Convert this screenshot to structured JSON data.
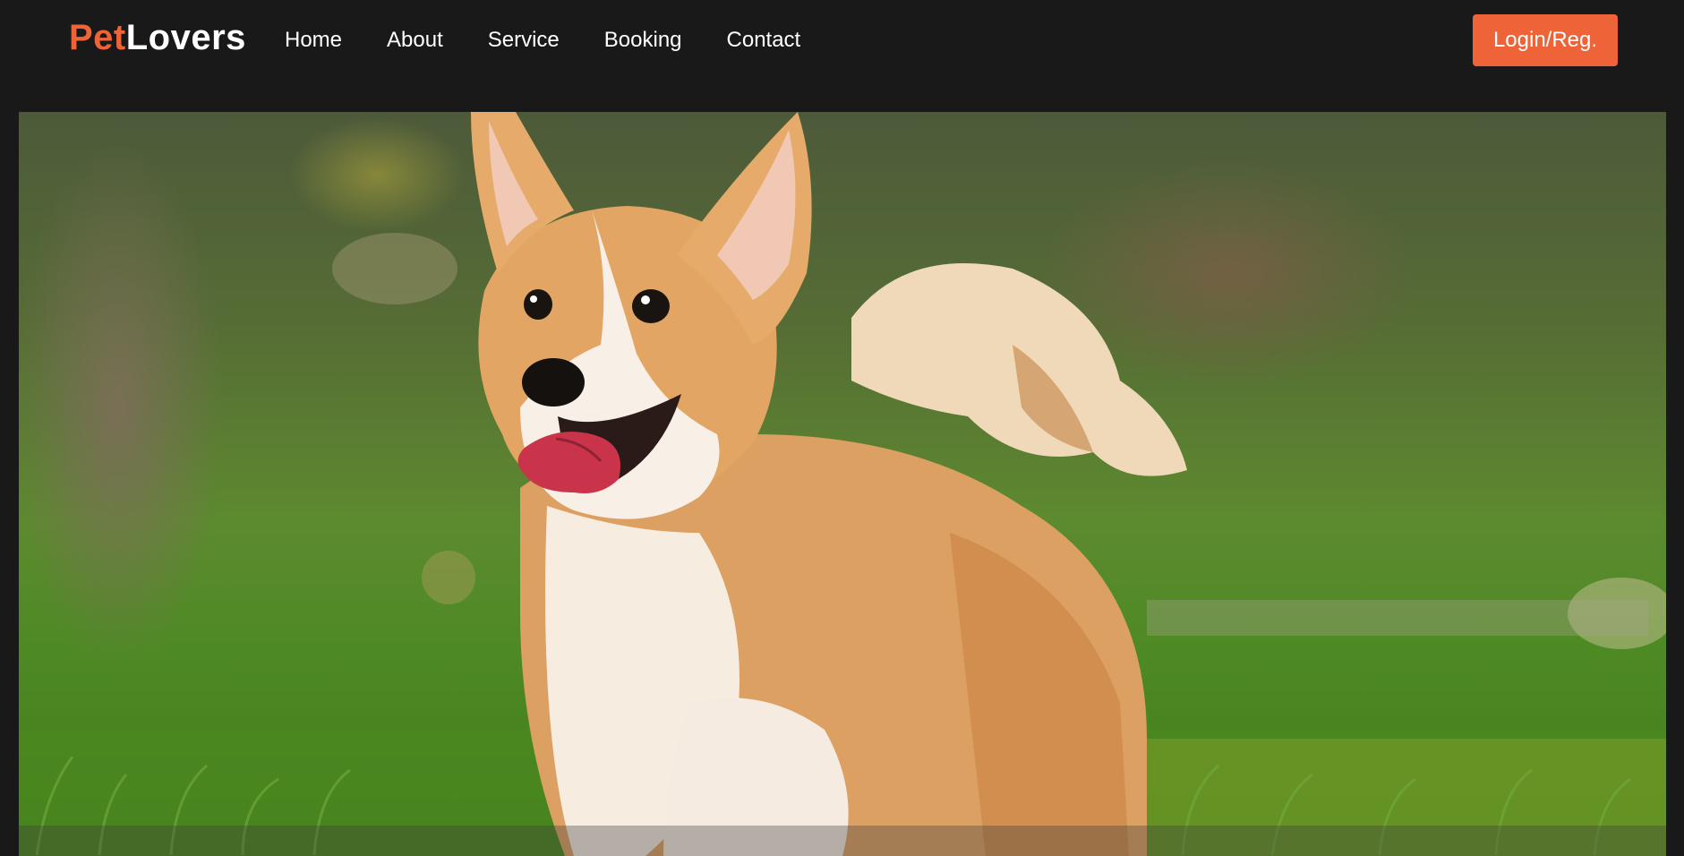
{
  "brand": {
    "part1": "Pet",
    "part2": "Lovers",
    "part1_color": "#ee6337",
    "part2_color": "#ffffff"
  },
  "nav": {
    "items": [
      {
        "label": "Home"
      },
      {
        "label": "About"
      },
      {
        "label": "Service"
      },
      {
        "label": "Booking"
      },
      {
        "label": "Contact"
      }
    ]
  },
  "header": {
    "login_label": "Login/Reg.",
    "accent_color": "#ee6337",
    "background_color": "#191919"
  },
  "hero": {
    "image": "corgi-running-in-grass"
  }
}
